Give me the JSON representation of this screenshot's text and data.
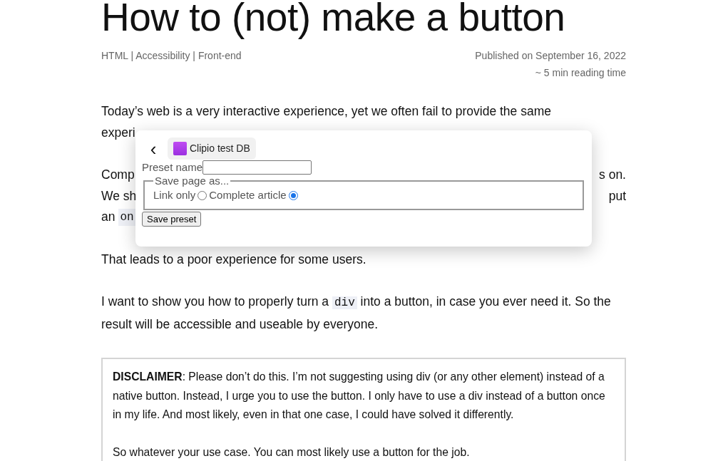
{
  "title": "How to (not) make a button",
  "tags": "HTML | Accessibility | Front-end",
  "published": "Published on September 16, 2022",
  "reading_time": "~ 5 min reading time",
  "paragraphs": [
    {
      "kind": "lines",
      "lines": [
        {
          "left": "Today’s web is a very interactive experience, yet we often fail to provide the same"
        },
        {
          "left": "experi"
        }
      ]
    },
    {
      "kind": "lines",
      "lines": [
        {
          "left": "Comp",
          "right": "s on."
        },
        {
          "left": "We sh",
          "right": "put"
        },
        {
          "left": "an",
          "code": "on"
        }
      ]
    },
    {
      "kind": "text",
      "before": "That leads to a poor experience for some users."
    },
    {
      "kind": "text",
      "before": "I want to show you how to properly turn a",
      "code": "div",
      "after": "into a button, in case you ever need it. So the result will be accessible and useable by everyone."
    }
  ],
  "disclaimer": [
    "**DISCLAIMER**: Please don’t do this. I’m not suggesting using div (or any other element) instead of a native button. Instead, I urge you to use the button. I only have to use a div instead of a button once in my life. And most likely, even in that one case, I could have solved it differently.",
    "So whatever your use case. You can most likely use a button for the job."
  ],
  "popup": {
    "back": "‹",
    "database": "Clipio test DB",
    "preset_label": "Preset name",
    "legend": "Save page as...",
    "options": [
      {
        "label": "Link only",
        "selected": false
      },
      {
        "label": "Complete article",
        "selected": true
      }
    ],
    "save_button": "Save preset"
  }
}
